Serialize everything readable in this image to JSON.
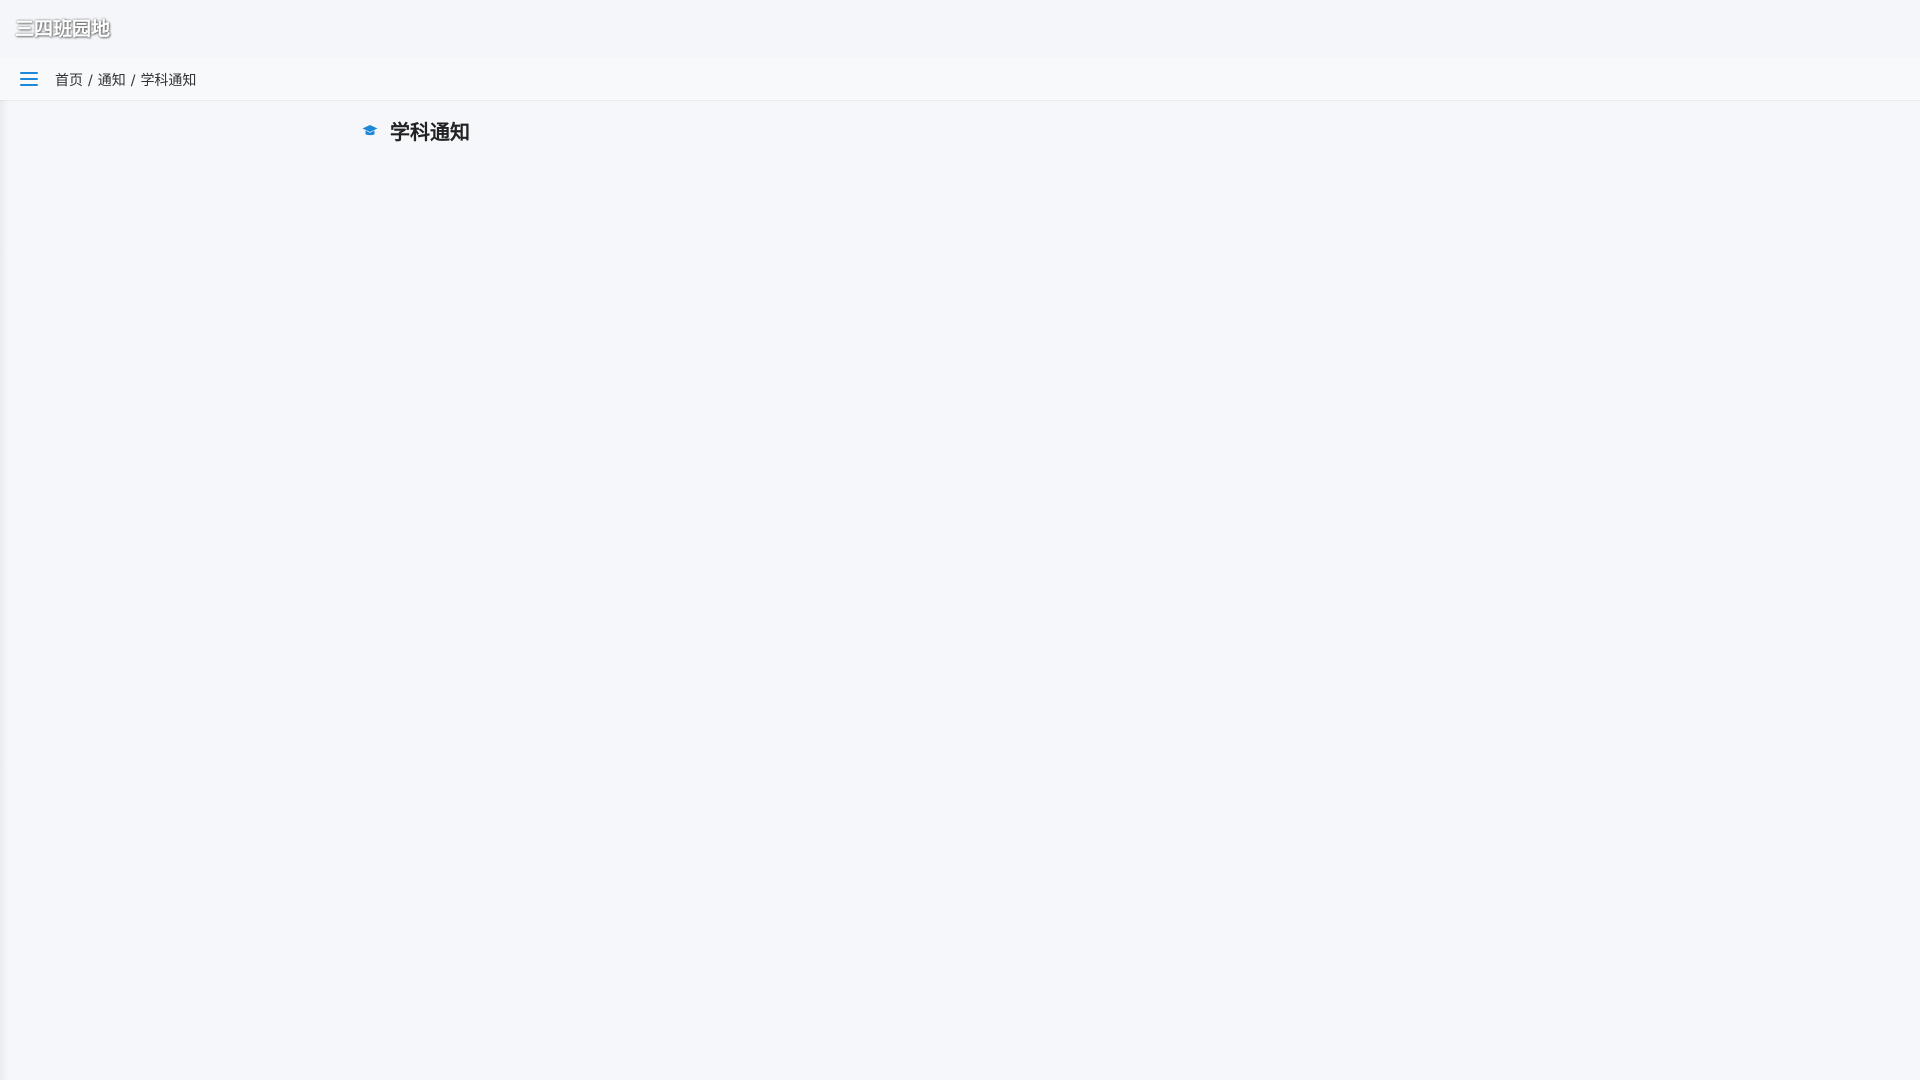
{
  "site": {
    "title": "三四班园地"
  },
  "nav": {
    "menu_icon": "hamburger-menu-icon",
    "breadcrumb": {
      "home": "首页",
      "separator": "/",
      "section": "通知",
      "current": "学科通知"
    }
  },
  "main": {
    "heading": "学科通知",
    "heading_icon": "graduation-cap-icon"
  },
  "colors": {
    "accent": "#1e88d8",
    "background": "#f5f7fa",
    "heading_text": "#222222"
  }
}
